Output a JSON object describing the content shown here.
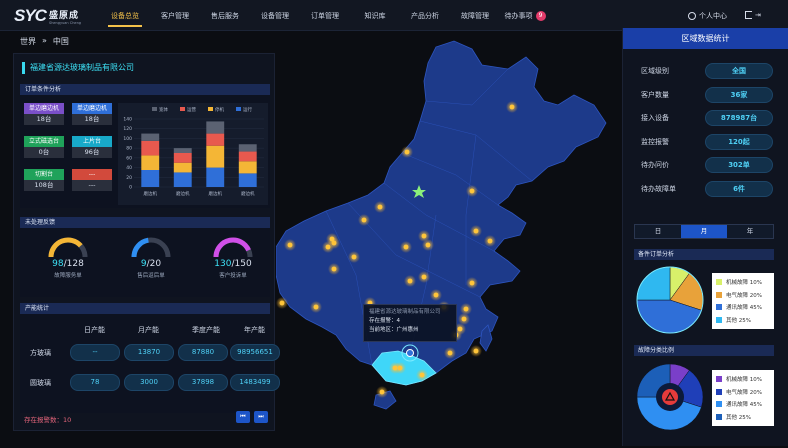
{
  "app": {
    "logo_mark": "SYC",
    "logo_cn": "盛原成",
    "logo_sub": "Shengyuan Cheng"
  },
  "nav": [
    {
      "label": "设备总览",
      "active": true
    },
    {
      "label": "客户管理"
    },
    {
      "label": "售后服务"
    },
    {
      "label": "设备管理"
    },
    {
      "label": "订单管理"
    },
    {
      "label": "知识库"
    },
    {
      "label": "产品分析"
    },
    {
      "label": "故障管理"
    },
    {
      "label": "待办事项",
      "badge": "9"
    }
  ],
  "user": {
    "label": "个人中心",
    "logout_icon": "logout-icon"
  },
  "breadcrumb": {
    "level1": "世界",
    "sep": "»",
    "level2": "中国"
  },
  "left": {
    "company": "福建省源达玻璃制品有限公司",
    "order_title": "订单条件分析",
    "tiles": [
      {
        "label": "单边磨边机",
        "value": "18台",
        "color": "#7a4fc9"
      },
      {
        "label": "单边磨边机",
        "value": "18台",
        "color": "#2f6fd8"
      },
      {
        "label": "立式磁选台",
        "value": "0台",
        "color": "#1fa25a"
      },
      {
        "label": "上片台",
        "value": "96台",
        "color": "#18a9c9"
      },
      {
        "label": "切割台",
        "value": "108台",
        "color": "#1fa25a"
      },
      {
        "label": "---",
        "value": "---",
        "color": "#d24a3c"
      }
    ],
    "pending_title": "未处理反馈",
    "gauges": [
      {
        "value": "98",
        "total": "128",
        "caption": "故障服务单",
        "color": "#f4b636",
        "ratio": 0.77
      },
      {
        "value": "9",
        "total": "20",
        "caption": "售后返后单",
        "color": "#2f8ff2",
        "ratio": 0.45
      },
      {
        "value": "130",
        "total": "150",
        "caption": "客户投诉单",
        "color": "#d04fe8",
        "ratio": 0.87
      }
    ],
    "capacity_title": "产能统计",
    "capacity_cols": [
      "日产能",
      "月产能",
      "季度产能",
      "年产能"
    ],
    "capacity_rows": [
      {
        "label": "方玻璃",
        "values": [
          "--",
          "13870",
          "87880",
          "98956651"
        ]
      },
      {
        "label": "圆玻璃",
        "values": [
          "78",
          "3000",
          "37898",
          "1483499"
        ]
      }
    ],
    "alarm_label": "存在报警数：",
    "alarm_count": "10",
    "pager_prev": "⏮",
    "pager_next": "⏭"
  },
  "chart_data": {
    "type": "bar",
    "stacked": true,
    "categories": [
      "磨边机",
      "磨边机",
      "磨边机",
      "磨边机"
    ],
    "series": [
      {
        "name": "蓝色",
        "color": "#2f6fd8",
        "values": [
          35,
          30,
          40,
          28
        ]
      },
      {
        "name": "黄色",
        "color": "#f4b636",
        "values": [
          30,
          20,
          45,
          25
        ]
      },
      {
        "name": "红色",
        "color": "#e8594e",
        "values": [
          30,
          20,
          25,
          20
        ]
      },
      {
        "name": "灰色",
        "color": "#5b6272",
        "values": [
          15,
          10,
          25,
          15
        ]
      }
    ],
    "legend": [
      "宽体",
      "运营",
      "停机",
      "运行"
    ],
    "legend_colors": [
      "#5b6272",
      "#e8594e",
      "#f4b636",
      "#2f6fd8"
    ],
    "yticks": [
      0,
      20,
      40,
      60,
      80,
      100,
      120,
      140
    ],
    "ylim": [
      0,
      140
    ],
    "grid": true
  },
  "map": {
    "tooltip_company": "福建省源达玻璃制品有限公司",
    "tooltip_alarm_label": "存在报警：",
    "tooltip_alarm_value": "4",
    "tooltip_area_label": "当前地区：",
    "tooltip_area_value": "广州惠州"
  },
  "right": {
    "title": "区域数据统计",
    "stats": [
      {
        "k": "区域级别",
        "v": "全国"
      },
      {
        "k": "客户数量",
        "v": "36家"
      },
      {
        "k": "接入设备",
        "v": "878987台"
      },
      {
        "k": "监控报警",
        "v": "120起"
      },
      {
        "k": "待办问价",
        "v": "302单"
      },
      {
        "k": "待办故障单",
        "v": "6件"
      }
    ],
    "tabs": [
      "日",
      "月",
      "年"
    ],
    "active_tab": "月",
    "pie1": {
      "title": "备件订单分析",
      "items": [
        {
          "label": "机械故障 10%",
          "color": "#d8f06a",
          "value": 10
        },
        {
          "label": "电气故障 20%",
          "color": "#e8a23a",
          "value": 20
        },
        {
          "label": "通讯故障 45%",
          "color": "#2f6fd8",
          "value": 45
        },
        {
          "label": "其他 25%",
          "color": "#2fb8f0",
          "value": 25
        }
      ]
    },
    "pie2": {
      "title": "故障分类比例",
      "items": [
        {
          "label": "机械故障 10%",
          "color": "#7a3fc9",
          "value": 10
        },
        {
          "label": "电气故障 20%",
          "color": "#1f3fb8",
          "value": 20
        },
        {
          "label": "通讯故障 45%",
          "color": "#2f8ff2",
          "value": 45
        },
        {
          "label": "其他 25%",
          "color": "#1c5fb8",
          "value": 25
        }
      ]
    }
  }
}
